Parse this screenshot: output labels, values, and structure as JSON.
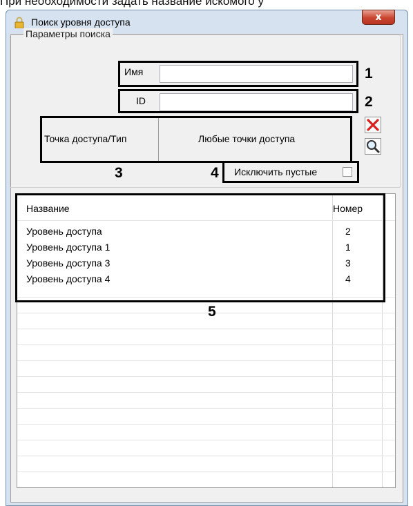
{
  "page_caption": "При необходимости задать название искомого у",
  "window": {
    "title": "Поиск уровня доступа",
    "close_label": "x"
  },
  "search_params": {
    "group_label": "Параметры поиска",
    "name_label": "Имя",
    "name_value": "",
    "id_label": "ID",
    "id_value": "",
    "access_point_label": "Точка доступа/Тип",
    "access_point_value": "Любые точки доступа",
    "exclude_empty_label": "Исключить пустые",
    "exclude_empty_checked": false
  },
  "callouts": [
    "1",
    "2",
    "3",
    "4",
    "5"
  ],
  "table": {
    "columns": [
      "Название",
      "Номер"
    ],
    "rows": [
      {
        "name": "Уровень доступа",
        "number": "2"
      },
      {
        "name": "Уровень доступа 1",
        "number": "1"
      },
      {
        "name": "Уровень доступа 3",
        "number": "3"
      },
      {
        "name": "Уровень доступа 4",
        "number": "4"
      }
    ]
  },
  "icons": {
    "title": "lock-icon",
    "clear": "red-x-icon",
    "search": "magnifier-icon"
  },
  "colors": {
    "window_frame": "#d6e2f0",
    "close_button": "#c9452f",
    "clear_icon": "#d9201c"
  }
}
